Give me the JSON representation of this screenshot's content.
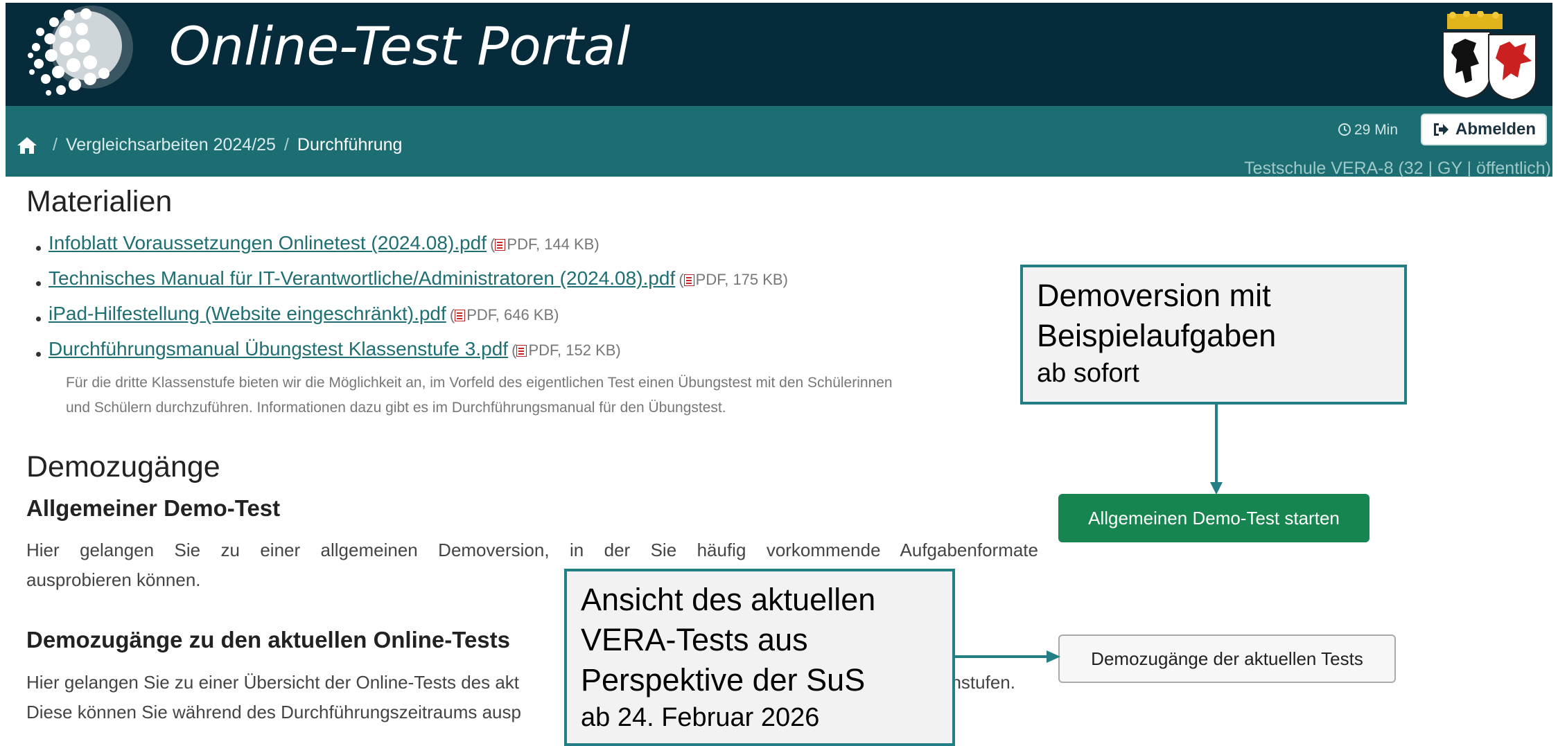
{
  "header": {
    "title": "Online-Test Portal"
  },
  "nav": {
    "breadcrumb": [
      "Vergleichsarbeiten 2024/25",
      "Durchführung"
    ],
    "separator": "/",
    "timer": "29 Min",
    "logout_label": "Abmelden",
    "school": "Testschule VERA-8 (32 | GY | öffentlich)"
  },
  "materials": {
    "heading": "Materialien",
    "items": [
      {
        "link": "Infoblatt Voraussetzungen Onlinetest (2024.08).pdf",
        "meta_pre": "(",
        "meta": "PDF, 144 KB)"
      },
      {
        "link": "Technisches Manual für IT-Verantwortliche/Administratoren (2024.08).pdf",
        "meta_pre": "(",
        "meta": "PDF, 175 KB)"
      },
      {
        "link": "iPad-Hilfestellung (Website eingeschränkt).pdf",
        "meta_pre": "(",
        "meta": "PDF, 646 KB)"
      },
      {
        "link": "Durchführungsmanual Übungstest Klassenstufe 3.pdf",
        "meta_pre": "(",
        "meta": "PDF, 152 KB)"
      }
    ],
    "note_line1": "Für die dritte Klassenstufe bieten wir die Möglichkeit an, im Vorfeld des eigentlichen Test einen Übungstest mit den Schülerinnen",
    "note_line2": "und Schülern durchzuführen. Informationen dazu gibt es im Durchführungsmanual für den Übungstest."
  },
  "demo": {
    "heading": "Demozugänge",
    "general": {
      "heading": "Allgemeiner Demo-Test",
      "line1": "Hier gelangen Sie zu einer allgemeinen Demoversion, in der Sie häufig vorkommende Aufgabenformate",
      "line2": "ausprobieren können.",
      "button": "Allgemeinen Demo-Test starten"
    },
    "current": {
      "heading": "Demozugänge zu den aktuellen Online-Tests",
      "line1_a": "Hier gelangen Sie zu einer Übersicht der Online-Tests des akt",
      "line1_b": "enstufen.",
      "line2": "Diese können Sie während des Durchführungszeitraums ausp",
      "button": "Demozugänge der aktuellen Tests"
    }
  },
  "callouts": {
    "first": {
      "line1": "Demoversion mit",
      "line2": "Beispielaufgaben",
      "line3": "ab sofort"
    },
    "second": {
      "line1": "Ansicht des aktuellen",
      "line2": "VERA-Tests aus",
      "line3": "Perspektive der SuS",
      "line4": "ab 24. Februar 2026"
    }
  },
  "colors": {
    "header_bg": "#062c3c",
    "nav_bg": "#1d6e73",
    "link": "#1f6f72",
    "accent_green": "#17854f",
    "callout_border": "#237f83"
  }
}
